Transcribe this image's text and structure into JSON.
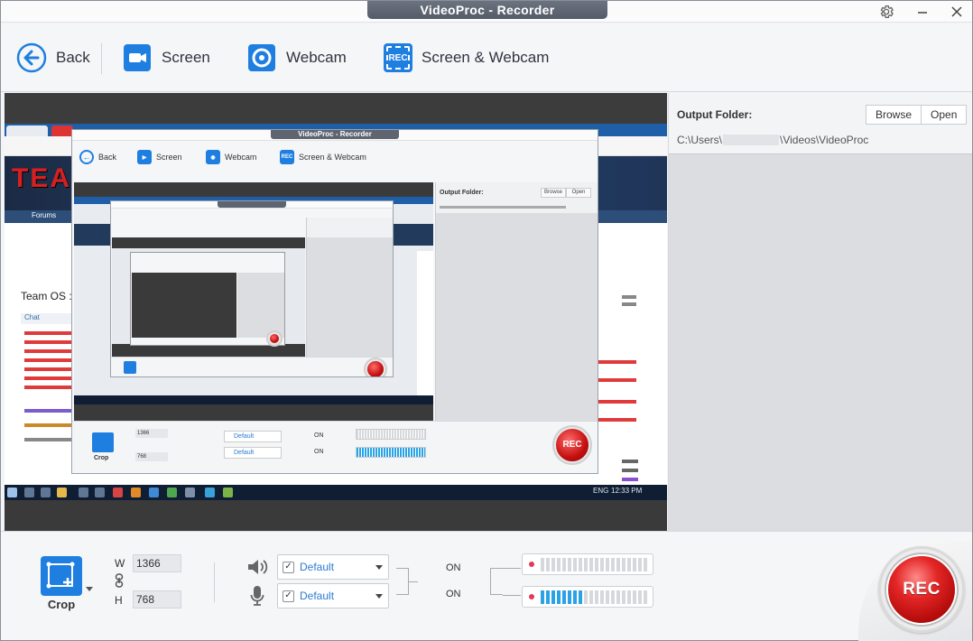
{
  "window": {
    "title": "VideoProc - Recorder"
  },
  "toolbar": {
    "back_label": "Back",
    "screen_label": "Screen",
    "webcam_label": "Webcam",
    "screen_webcam_label": "Screen & Webcam",
    "screen_webcam_badge": "REC"
  },
  "icons": {
    "settings": "gear-icon",
    "minimize": "minimize-icon",
    "close": "close-icon",
    "back": "back-arrow-icon",
    "screen": "monitor-camera-icon",
    "webcam": "webcam-icon",
    "screen_webcam": "rec-screen-icon",
    "crop": "crop-icon",
    "link": "link-icon",
    "speaker": "speaker-icon",
    "microphone": "microphone-icon"
  },
  "preview": {
    "nested_title": "VideoProc - Recorder",
    "nested_back": "Back",
    "nested_screen": "Screen",
    "nested_webcam": "Webcam",
    "nested_screen_webcam": "Screen & Webcam",
    "nested_output": "Output Folder:",
    "nested_browse": "Browse",
    "nested_open": "Open",
    "nested_crop": "Crop",
    "nested_w": "1366",
    "nested_h": "768",
    "nested_default": "Default",
    "nested_on": "ON",
    "nested_rec": "REC",
    "site_banner": "TEA",
    "site_tab": "Forums",
    "site_heading": "Team OS :",
    "site_chat": "Chat",
    "taskbar_lang": "ENG",
    "taskbar_time": "12:33 PM"
  },
  "output": {
    "label": "Output Folder:",
    "browse_label": "Browse",
    "open_label": "Open",
    "path_prefix": "C:\\Users\\",
    "path_suffix": "\\Videos\\VideoProc"
  },
  "capture": {
    "crop_label": "Crop",
    "w_label": "W",
    "h_label": "H",
    "width": "1366",
    "height": "768"
  },
  "audio": {
    "speaker_device": "Default",
    "mic_device": "Default",
    "speaker_state": "ON",
    "mic_state": "ON",
    "speaker_level": 0,
    "mic_level": 0.4
  },
  "rec": {
    "label": "REC"
  },
  "colors": {
    "accent": "#1f7fe0",
    "rec": "#d61a1a",
    "meter_on": "#2aa3e6",
    "meter_dot": "#e23a55"
  }
}
